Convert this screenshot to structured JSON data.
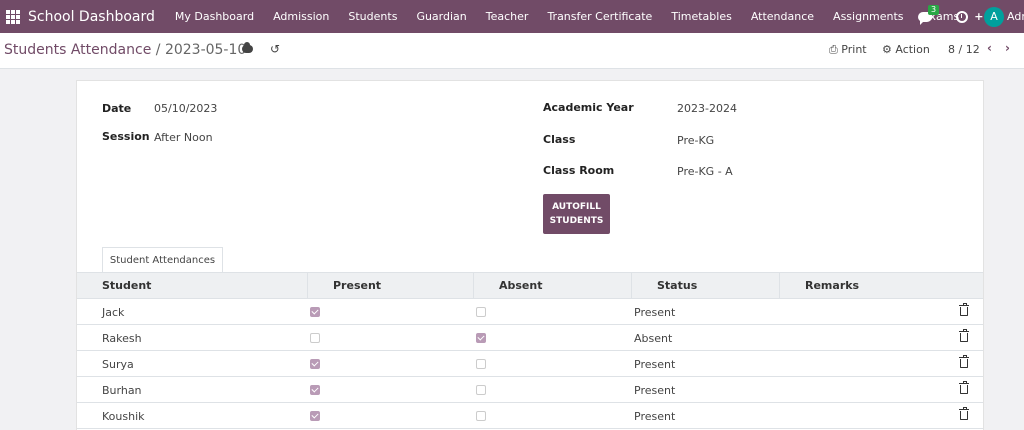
{
  "navbar": {
    "brand": "School Dashboard",
    "menu": [
      "My Dashboard",
      "Admission",
      "Students",
      "Guardian",
      "Teacher",
      "Transfer Certificate",
      "Timetables",
      "Attendance",
      "Assignments",
      "Exams"
    ],
    "plus": "+",
    "chat_count": "3",
    "avatar_letter": "A",
    "user": "Adm"
  },
  "control_panel": {
    "breadcrumb_parent": "Students Attendance",
    "separator": "/",
    "breadcrumb_current": "2023-05-10",
    "print_label": "Print",
    "action_label": "Action",
    "pager": "8 / 12"
  },
  "form": {
    "date_label": "Date",
    "date_value": "05/10/2023",
    "session_label": "Session",
    "session_value": "After Noon",
    "academic_year_label": "Academic Year",
    "academic_year_value": "2023-2024",
    "class_label": "Class",
    "class_value": "Pre-KG",
    "class_room_label": "Class Room",
    "class_room_value": "Pre-KG - A",
    "autofill_label": "AUTOFILL\nSTUDENTS",
    "tab_label": "Student Attendances"
  },
  "table": {
    "headers": [
      "Student",
      "Present",
      "Absent",
      "Status",
      "Remarks"
    ],
    "rows": [
      {
        "student": "Jack",
        "present": true,
        "absent": false,
        "status": "Present",
        "remarks": ""
      },
      {
        "student": "Rakesh",
        "present": false,
        "absent": true,
        "status": "Absent",
        "remarks": ""
      },
      {
        "student": "Surya",
        "present": true,
        "absent": false,
        "status": "Present",
        "remarks": ""
      },
      {
        "student": "Burhan",
        "present": true,
        "absent": false,
        "status": "Present",
        "remarks": ""
      },
      {
        "student": "Koushik",
        "present": true,
        "absent": false,
        "status": "Present",
        "remarks": ""
      }
    ]
  },
  "colors": {
    "brand": "#714b67",
    "checkbox": "#b99bb6",
    "badge": "#28a745",
    "avatar": "#00a09d"
  }
}
